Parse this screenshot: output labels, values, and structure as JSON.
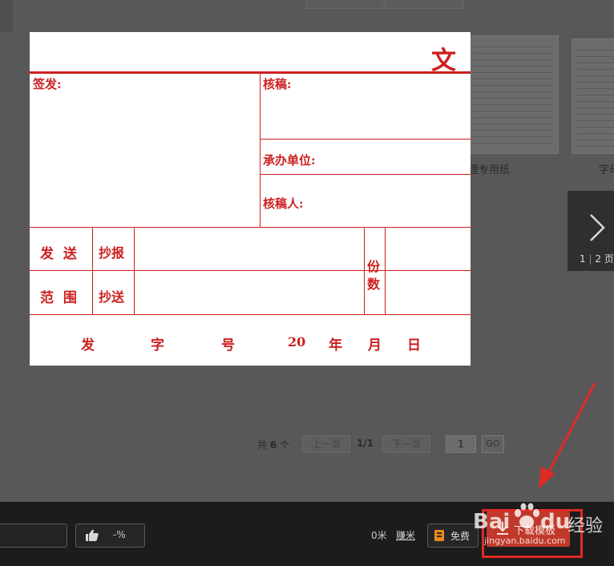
{
  "document": {
    "type_char": "文",
    "qianfa_label": "签发:",
    "hegao_label": "核稿:",
    "chengban_label": "承办单位:",
    "hegaoren_label": "核稿人:",
    "fasong_label": "发  送",
    "fanwei_label": "范  围",
    "chaobao_label": "抄报",
    "chaosong_label": "抄送",
    "fen_label": "份",
    "shu_label": "数",
    "footer": {
      "fa": "发",
      "zi": "字",
      "hao": "号",
      "year_prefix": "20",
      "nian": "年",
      "yue": "月",
      "ri": "日"
    }
  },
  "background": {
    "thumb1_caption": "理专用纸",
    "thumb2_caption": "字母",
    "pager": {
      "current": "1",
      "separator": "|",
      "total": "2",
      "unit": "页"
    }
  },
  "pagination": {
    "total_prefix": "共",
    "total_count": "6",
    "total_suffix": "个",
    "prev_label": "上一页",
    "position": "1/1",
    "next_label": "下一页",
    "page_input_value": "1",
    "go_label": "GO"
  },
  "bottom_bar": {
    "like_value": "-%",
    "distance": "0米",
    "earn_label": "赚米",
    "free_label": "免费",
    "download_label": "下载模板"
  },
  "watermark": {
    "brand_en_1": "Bai",
    "brand_en_2": "du",
    "brand_cn": "经验",
    "url": "jingyan.baidu.com"
  },
  "colors": {
    "document_red": "#cc1f1f",
    "download_button": "#c0392b",
    "annotation_red": "#e02a24"
  },
  "icons": [
    "thumbs-up-icon",
    "bookmark-icon",
    "download-icon",
    "chevron-right-icon",
    "paw-icon",
    "arrow-annotation"
  ]
}
